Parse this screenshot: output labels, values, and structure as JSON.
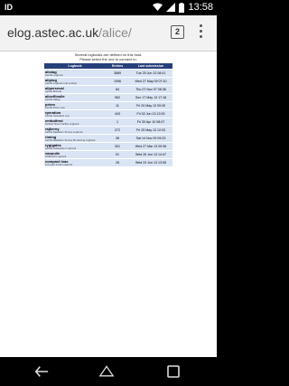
{
  "status_bar": {
    "left_label": "ID",
    "time": "13:58"
  },
  "browser": {
    "url_host": "elog.astec.ac.uk",
    "url_path": "/alice/",
    "tab_count": "2"
  },
  "notice": {
    "line1": "Several logbooks are defined on this host.",
    "line2": "Please select the one to connect to:"
  },
  "table": {
    "headers": [
      "Logbook",
      "Entries",
      "Last submission"
    ],
    "rows": [
      {
        "name": "alioiag",
        "sub": "ALICE Logbook",
        "entries": "3689",
        "last": "Tue 25 Jun 13 08:41"
      },
      {
        "name": "aliplog",
        "sub": "ALICE Logbook (old entries)",
        "entries": "1096",
        "last": "Wed 27 May 09 07:10"
      },
      {
        "name": "aliperseval",
        "sub": "ALICE Manual",
        "entries": "84",
        "last": "Thu 07 Nov 07 08:38"
      },
      {
        "name": "aliceflinslle",
        "sub": "ALICE Safety",
        "entries": "962",
        "last": "Sun 17 May 13 17:18"
      },
      {
        "name": "prism",
        "sub": "ALICE Prism Gun",
        "entries": "11",
        "last": "Fri 20 May 13 09:30"
      },
      {
        "name": "rperation",
        "sub": "ALICE Operation Log",
        "entries": "443",
        "last": "Fri 02 Jun 13 12:00"
      },
      {
        "name": "emfudfred",
        "sub": "Optical Timer Facility Logbook",
        "entries": "1",
        "last": "Fri 30 Apr 10 08:07"
      },
      {
        "name": "rajkerny",
        "sub": "ALICE Radiation Survey Logbook",
        "entries": "272",
        "last": "Fri 25 May 13 12:03"
      },
      {
        "name": "rlming",
        "sub": "ALICE Radiation Survey Monitoring Logbook",
        "entries": "38",
        "last": "Sat 14 Nov 09 09:23"
      },
      {
        "name": "rygigates",
        "sub": "ALICE Subsystem Logbook",
        "entries": "301",
        "last": "Wed 27 Mar 13 09:36"
      },
      {
        "name": "vauuuile",
        "sub": "LINEVAC Logbook",
        "entries": "91",
        "last": "Wed 26 Jun 13 14:47"
      },
      {
        "name": "compact lnac",
        "sub": "Compact Linac Logbook",
        "entries": "28",
        "last": "Wed 24 Jun 13 13:06"
      }
    ]
  },
  "icons": {
    "wifi": "wifi-icon",
    "signal": "signal-icon",
    "battery": "battery-icon",
    "back": "back-icon",
    "home": "home-icon",
    "recents": "recents-icon",
    "menu": "overflow-menu-icon"
  }
}
